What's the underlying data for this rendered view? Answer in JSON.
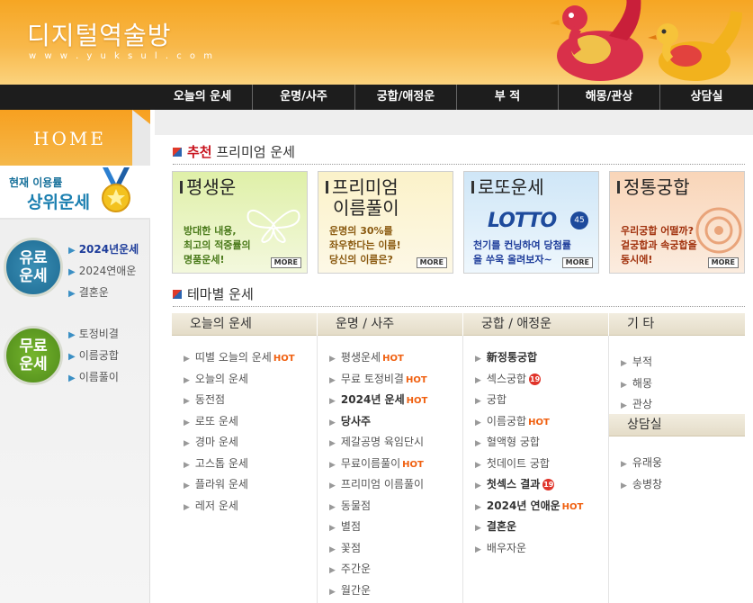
{
  "header": {
    "logo_title": "디지털역술방",
    "logo_url": "w w w . y u k s u l . c o m"
  },
  "nav": [
    {
      "label": "오늘의 운세",
      "width": 110
    },
    {
      "label": "운명/사주",
      "width": 114
    },
    {
      "label": "궁합/애정운",
      "width": 113
    },
    {
      "label": "부 적",
      "width": 113
    },
    {
      "label": "해몽/관상",
      "width": 113
    },
    {
      "label": "상담실",
      "width": 104
    }
  ],
  "sidebar": {
    "home_label": "HOME",
    "rank_small": "현재 이용률",
    "rank_big": "상위운세",
    "paid_badge": "유료\n운세",
    "paid_items": [
      "2024년운세",
      "2024연애운",
      "결혼운"
    ],
    "free_badge": "무료\n운세",
    "free_items": [
      "토정비결",
      "이름궁합",
      "이름풀이"
    ]
  },
  "recommend": {
    "head_red": "추천",
    "head_rest": " 프리미엄 운세",
    "banners": [
      {
        "title": "평생운",
        "desc": [
          "방대한 내용,",
          "최고의 적중률의",
          "명품운세!"
        ],
        "more": "MORE"
      },
      {
        "title": "프리미엄",
        "title2": "이름풀이",
        "desc": [
          "운명의 30%를",
          "좌우한다는 이름!",
          "당신의 이름은?"
        ],
        "more": "MORE"
      },
      {
        "title": "로또운세",
        "lotto": "LOTTO",
        "ball": "45",
        "desc": [
          "천기를 컨닝하여 당첨률",
          "을 쑤욱 올려보자~"
        ],
        "more": "MORE"
      },
      {
        "title": "정통궁합",
        "desc": [
          "우리궁합 어떨까?",
          "겉궁합과 속궁합을",
          "동시에!"
        ],
        "more": "MORE"
      }
    ]
  },
  "theme": {
    "head": "테마별 운세",
    "columns": [
      {
        "title": "오늘의 운세",
        "items": [
          {
            "t": "띠별 오늘의 운세",
            "hot": "HOT"
          },
          {
            "t": "오늘의 운세"
          },
          {
            "t": "동전점"
          },
          {
            "t": "로또 운세"
          },
          {
            "t": "경마 운세"
          },
          {
            "t": "고스톱 운세"
          },
          {
            "t": "플라워 운세"
          },
          {
            "t": "레저 운세"
          }
        ]
      },
      {
        "title": "운명 / 사주",
        "items": [
          {
            "t": "평생운세",
            "hot": "HOT"
          },
          {
            "t": "무료 토정비결",
            "hot": "HOT"
          },
          {
            "t": "2024년 운세",
            "hot": "HOT",
            "bold": true
          },
          {
            "t": "당사주",
            "bold": true
          },
          {
            "t": "제갈공명 육임단시"
          },
          {
            "t": "무료이름풀이",
            "hot": "HOT"
          },
          {
            "t": "프리미엄 이름풀이"
          },
          {
            "t": "동물점"
          },
          {
            "t": "별점"
          },
          {
            "t": "꽃점"
          },
          {
            "t": "주간운"
          },
          {
            "t": "월간운"
          }
        ]
      },
      {
        "title": "궁합 / 애정운",
        "items": [
          {
            "t": "新정통궁합",
            "bold": true
          },
          {
            "t": "섹스궁합",
            "age": "19"
          },
          {
            "t": "궁합"
          },
          {
            "t": "이름궁합",
            "hot": "HOT"
          },
          {
            "t": "혈액형 궁합"
          },
          {
            "t": "첫데이트 궁합"
          },
          {
            "t": "첫섹스 결과",
            "age": "19",
            "bold": true
          },
          {
            "t": "2024년 연애운",
            "hot": "HOT",
            "bold": true
          },
          {
            "t": "결혼운",
            "bold": true
          },
          {
            "t": "배우자운"
          }
        ]
      },
      {
        "title": "기   타",
        "items": [
          {
            "t": "부적"
          },
          {
            "t": "해몽"
          },
          {
            "t": "관상"
          }
        ],
        "sub_title": "상담실",
        "sub_items": [
          {
            "t": "유래웅"
          },
          {
            "t": "송병창"
          }
        ]
      }
    ]
  },
  "colors": {
    "header_orange": "#f6a623",
    "nav_bg": "#1d1d1d",
    "accent_red": "#c8141e",
    "hot_orange": "#f06010"
  }
}
